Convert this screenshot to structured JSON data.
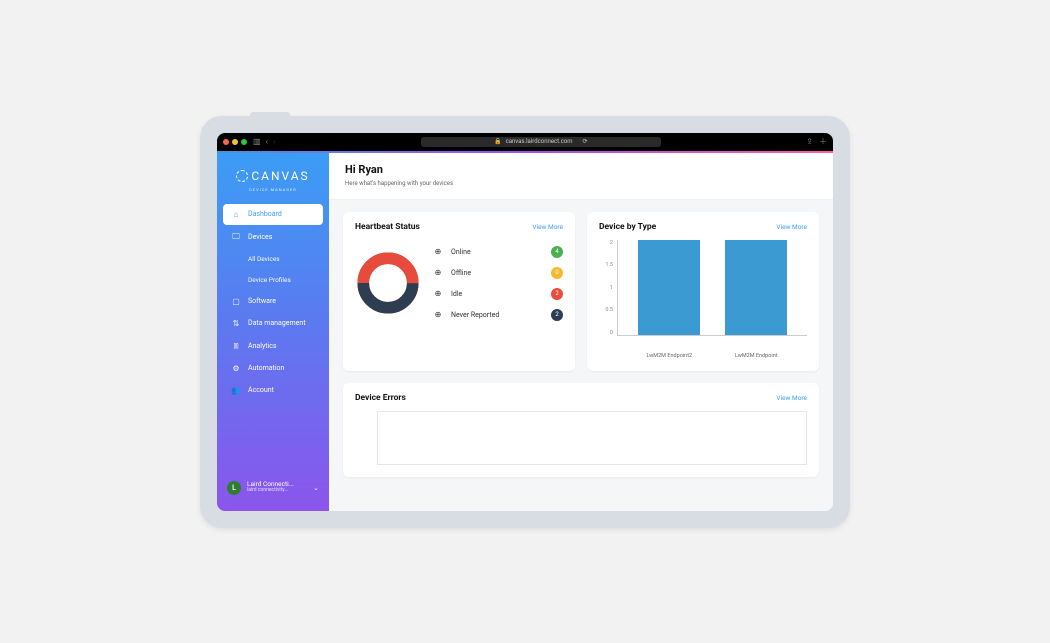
{
  "browser": {
    "url": "canvas.lairdconnect.com"
  },
  "brand": {
    "name": "CANVAS",
    "subtitle": "DEVICE MANAGER"
  },
  "sidebar": {
    "items": [
      {
        "label": "Dashboard"
      },
      {
        "label": "Devices"
      },
      {
        "label": "All Devices"
      },
      {
        "label": "Device Profiles"
      },
      {
        "label": "Software"
      },
      {
        "label": "Data management"
      },
      {
        "label": "Analytics"
      },
      {
        "label": "Automation"
      },
      {
        "label": "Account"
      }
    ]
  },
  "user": {
    "initial": "L",
    "name": "Laird Connecti...",
    "subtitle": "laird connectivity..."
  },
  "header": {
    "title": "Hi Ryan",
    "subtitle": "Here what's happening with your devices"
  },
  "cards": {
    "heartbeat": {
      "title": "Heartbeat Status",
      "view_more": "View More",
      "legend": [
        {
          "label": "Online",
          "value": "4"
        },
        {
          "label": "Offline",
          "value": "0"
        },
        {
          "label": "Idle",
          "value": "2"
        },
        {
          "label": "Never Reported",
          "value": "2"
        }
      ]
    },
    "device_type": {
      "title": "Device by Type",
      "view_more": "View More"
    },
    "device_errors": {
      "title": "Device Errors",
      "view_more": "View More"
    }
  },
  "chart_data": [
    {
      "name": "heartbeat",
      "type": "pie",
      "title": "Heartbeat Status",
      "series": [
        {
          "name": "Online",
          "value": 4,
          "color": "#4caf50"
        },
        {
          "name": "Offline",
          "value": 0,
          "color": "#f5b82e"
        },
        {
          "name": "Idle",
          "value": 2,
          "color": "#e74c3c"
        },
        {
          "name": "Never Reported",
          "value": 2,
          "color": "#2c3e50"
        }
      ]
    },
    {
      "name": "device_by_type",
      "type": "bar",
      "title": "Device by Type",
      "categories": [
        "LwM2M Endpoint2",
        "LwM2M Endpoint"
      ],
      "values": [
        2,
        2
      ],
      "ylim": [
        0,
        2
      ],
      "yticks": [
        0,
        0.5,
        1,
        1.5,
        2
      ],
      "ylabel": "",
      "xlabel": ""
    }
  ]
}
